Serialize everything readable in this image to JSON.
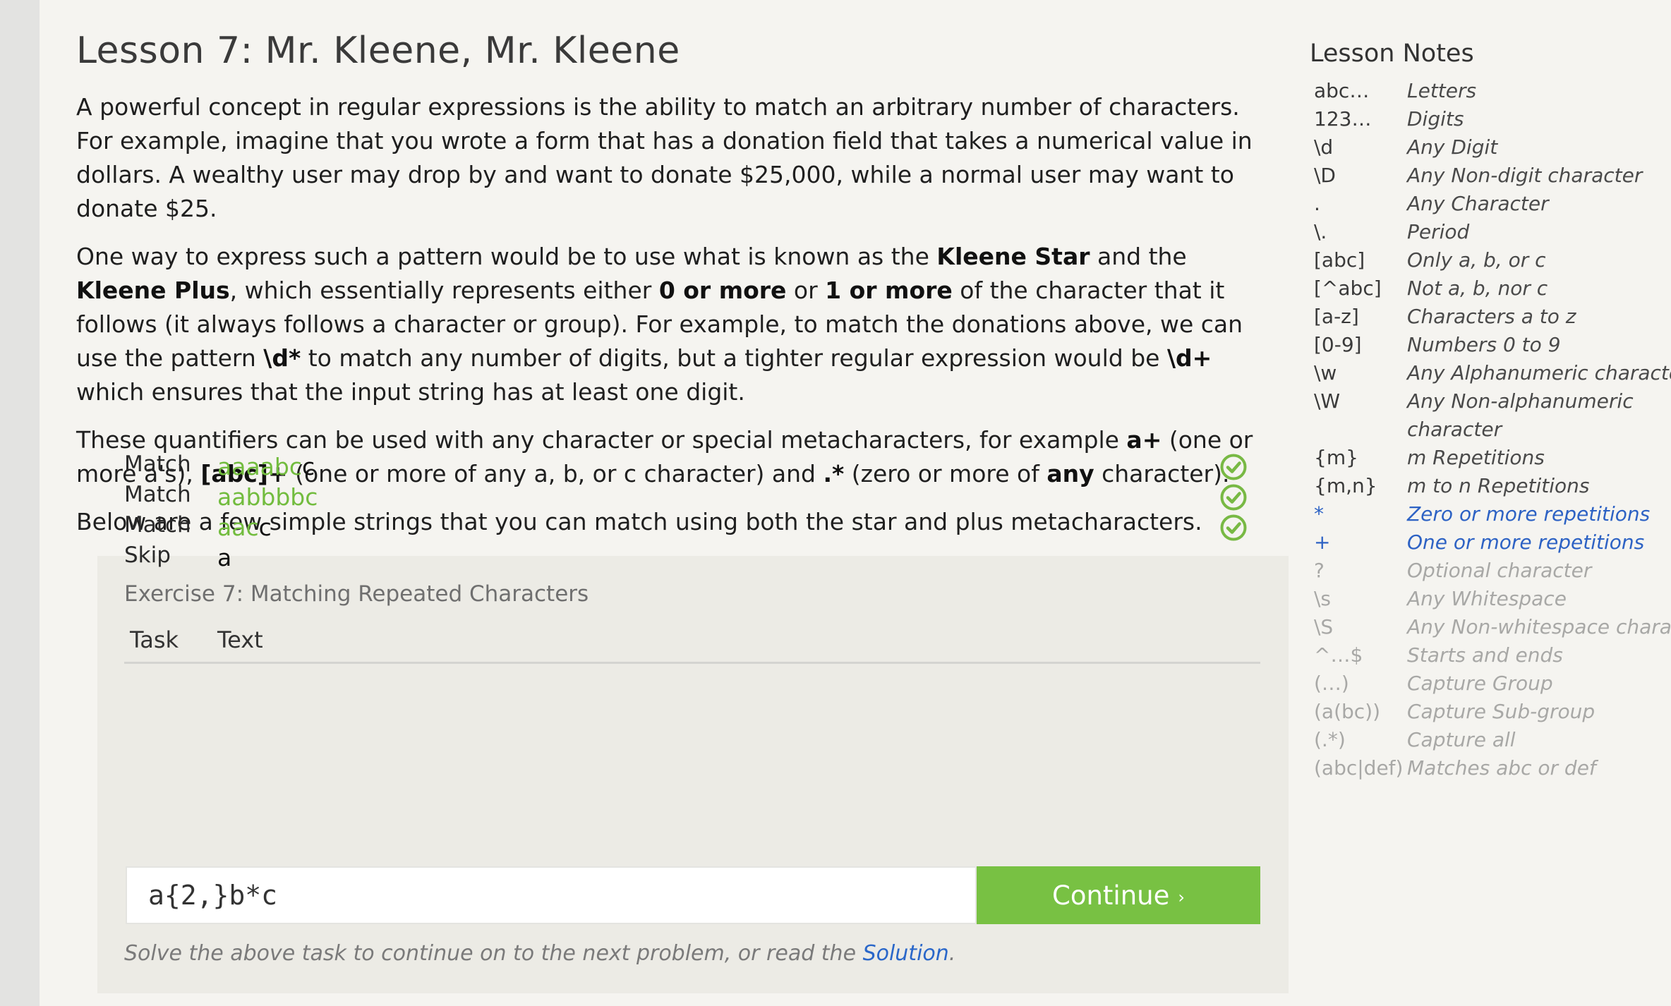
{
  "lesson": {
    "title": "Lesson 7: Mr. Kleene, Mr. Kleene",
    "paragraphs": [
      [
        {
          "t": "A powerful concept in regular expressions is the ability to match an arbitrary number of characters. For example, imagine that you wrote a form that has a donation field that takes a numerical value in dollars. A wealthy user may drop by and want to donate $25,000, while a normal user may want to donate $25."
        }
      ],
      [
        {
          "t": "One way to express such a pattern would be to use what is known as the "
        },
        {
          "t": "Kleene Star",
          "b": true
        },
        {
          "t": " and the "
        },
        {
          "t": "Kleene Plus",
          "b": true
        },
        {
          "t": ", which essentially represents either "
        },
        {
          "t": "0 or more",
          "b": true
        },
        {
          "t": " or "
        },
        {
          "t": "1 or more",
          "b": true
        },
        {
          "t": " of the character that it follows (it always follows a character or group). For example, to match the donations above, we can use the pattern "
        },
        {
          "t": "\\d*",
          "b": true
        },
        {
          "t": " to match any number of digits, but a tighter regular expression would be "
        },
        {
          "t": "\\d+",
          "b": true
        },
        {
          "t": " which ensures that the input string has at least one digit."
        }
      ],
      [
        {
          "t": "These quantifiers can be used with any character or special metacharacters, for example "
        },
        {
          "t": "a+",
          "b": true
        },
        {
          "t": " (one or more a's), "
        },
        {
          "t": "[abc]+",
          "b": true
        },
        {
          "t": " (one or more of any a, b, or c character) and "
        },
        {
          "t": ".*",
          "b": true
        },
        {
          "t": " (zero or more of "
        },
        {
          "t": "any",
          "b": true
        },
        {
          "t": " character)."
        }
      ],
      [
        {
          "t": "Below are a few simple strings that you can match using both the star and plus metacharacters."
        }
      ]
    ]
  },
  "exercise": {
    "title": "Exercise 7: Matching Repeated Characters",
    "col_task": "Task",
    "col_text": "Text",
    "rows": [
      {
        "task": "Match",
        "matched": "aaaabc",
        "unmatched": "c",
        "status": "check-icon"
      },
      {
        "task": "Match",
        "matched": "aabbbbc",
        "unmatched": "",
        "status": "check-icon"
      },
      {
        "task": "Match",
        "matched": "aac",
        "unmatched": "c",
        "status": "check-icon"
      },
      {
        "task": "Skip",
        "matched": "",
        "unmatched": "a",
        "status": ""
      }
    ],
    "input_value": "a{2,}b*c",
    "continue_label": "Continue",
    "continue_arrow": "›",
    "note_prefix": "Solve the above task to continue on to the next problem, or read the ",
    "solution_link": "Solution",
    "note_suffix": ".",
    "colors": {
      "match": "#72bc3e",
      "button": "#78c143",
      "link": "#2a67c9"
    }
  },
  "notes": {
    "title": "Lesson Notes",
    "items": [
      {
        "key": "abc…",
        "desc": "Letters",
        "state": "normal"
      },
      {
        "key": "123…",
        "desc": "Digits",
        "state": "normal"
      },
      {
        "key": "\\d",
        "desc": "Any Digit",
        "state": "normal"
      },
      {
        "key": "\\D",
        "desc": "Any Non-digit character",
        "state": "normal"
      },
      {
        "key": ".",
        "desc": "Any Character",
        "state": "normal"
      },
      {
        "key": "\\.",
        "desc": "Period",
        "state": "normal"
      },
      {
        "key": "[abc]",
        "desc": "Only a, b, or c",
        "state": "normal"
      },
      {
        "key": "[^abc]",
        "desc": "Not a, b, nor c",
        "state": "normal"
      },
      {
        "key": "[a-z]",
        "desc": "Characters a to z",
        "state": "normal"
      },
      {
        "key": "[0-9]",
        "desc": "Numbers 0 to 9",
        "state": "normal"
      },
      {
        "key": "\\w",
        "desc": "Any Alphanumeric character",
        "state": "normal"
      },
      {
        "key": "\\W",
        "desc": "Any Non-alphanumeric",
        "state": "normal"
      },
      {
        "key": "",
        "desc": "character",
        "state": "normal"
      },
      {
        "key": "{m}",
        "desc": "m Repetitions",
        "state": "normal"
      },
      {
        "key": "{m,n}",
        "desc": "m to n Repetitions",
        "state": "normal"
      },
      {
        "key": "*",
        "desc": "Zero or more repetitions",
        "state": "active"
      },
      {
        "key": "+",
        "desc": "One or more repetitions",
        "state": "active"
      },
      {
        "key": "?",
        "desc": "Optional character",
        "state": "future"
      },
      {
        "key": "\\s",
        "desc": "Any Whitespace",
        "state": "future"
      },
      {
        "key": "\\S",
        "desc": "Any Non-whitespace characte",
        "state": "future"
      },
      {
        "key": "^…$",
        "desc": "Starts and ends",
        "state": "future"
      },
      {
        "key": "(…)",
        "desc": "Capture Group",
        "state": "future"
      },
      {
        "key": "(a(bc))",
        "desc": "Capture Sub-group",
        "state": "future"
      },
      {
        "key": "(.*)",
        "desc": "Capture all",
        "state": "future"
      },
      {
        "key": "(abc|def)",
        "desc": "Matches abc or def",
        "state": "future"
      }
    ]
  }
}
